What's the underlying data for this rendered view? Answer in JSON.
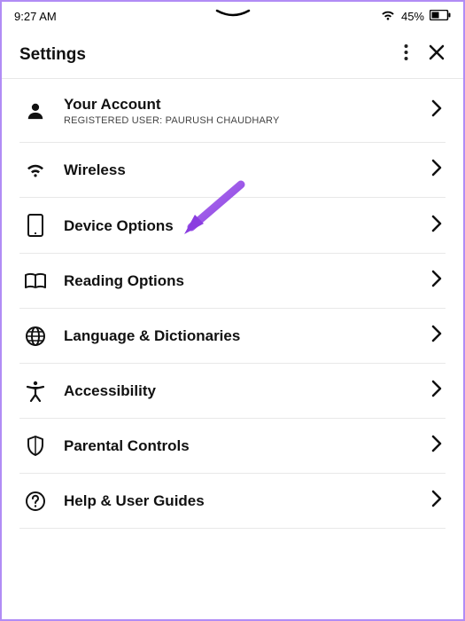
{
  "status": {
    "time": "9:27 AM",
    "battery_pct": "45%"
  },
  "header": {
    "title": "Settings"
  },
  "items": [
    {
      "id": "your-account",
      "icon": "person",
      "title": "Your Account",
      "subtitle": "REGISTERED USER: PAURUSH CHAUDHARY"
    },
    {
      "id": "wireless",
      "icon": "wifi",
      "title": "Wireless"
    },
    {
      "id": "device-options",
      "icon": "device",
      "title": "Device Options"
    },
    {
      "id": "reading-options",
      "icon": "book",
      "title": "Reading Options"
    },
    {
      "id": "language-dictionaries",
      "icon": "globe",
      "title": "Language & Dictionaries"
    },
    {
      "id": "accessibility",
      "icon": "accessibility",
      "title": "Accessibility"
    },
    {
      "id": "parental-controls",
      "icon": "shield",
      "title": "Parental Controls"
    },
    {
      "id": "help-user-guides",
      "icon": "help",
      "title": "Help & User Guides"
    }
  ],
  "annotation": {
    "type": "arrow",
    "color": "#9b4de0",
    "target": "device-options"
  }
}
